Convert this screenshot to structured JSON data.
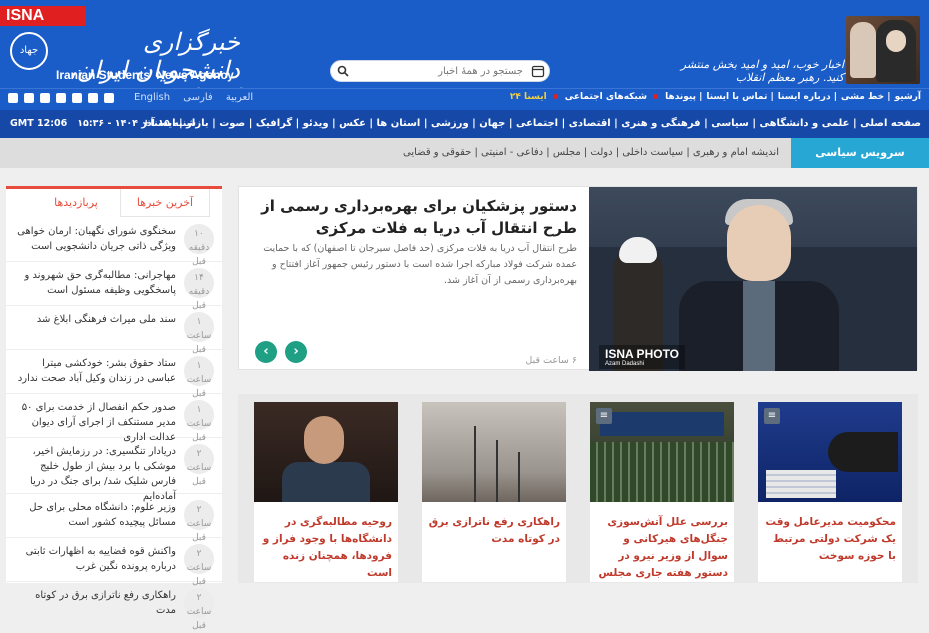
{
  "header": {
    "badge": "ISNA",
    "logo_text": "جهاد",
    "brand_fa": "خبرگزاری دانشجویان ایران، ایسنا",
    "brand_en": "Iranian Students' News Agency",
    "slogan": "اخبار خوب، امید و امید بخش منتشر کنید. رهبر معظم انقلاب",
    "search_placeholder": "جستجو در همهٔ اخبار"
  },
  "topbar": {
    "links": [
      "آرشیو",
      "خط مشی",
      "درباره ایسنا",
      "تماس با ایسنا",
      "پیوندها",
      "شبکه‌های اجتماعی",
      "ایسنا",
      "ایسنا ۲۴"
    ],
    "languages": [
      "فارسی",
      "العربیة",
      "English"
    ],
    "social_icons": [
      "telegram-icon",
      "whatsapp-icon",
      "youtube-icon",
      "twitter-icon",
      "instagram-icon",
      "facebook-icon",
      "rss-icon",
      "aparat-icon"
    ]
  },
  "menubar": {
    "items": "صفحه اصلی | علمی و دانشگاهی | سیاسی | فرهنگی و هنری | اقتصادی | اجتماعی | جهان | ورزشی | استان ها | عکس | ویدئو | گرافیک | صوت | بازار | ایسنا+",
    "date": "شنبه ۱۵ آذر ۱۴۰۴ - ۱۵:۳۶",
    "gmt": "GMT 12:06"
  },
  "subnav": {
    "section": "سرویس سیاسی",
    "items": "اندیشه امام و رهبری | سیاست داخلی | دولت | مجلس | دفاعی - امنیتی | حقوقی و قضایی"
  },
  "sidebar": {
    "tab_active": "آخرین خبرها",
    "tab_inactive": "پربازدیدها",
    "news": [
      {
        "title": "سخنگوی شورای نگهبان: ارمان خواهی ویژگی ذاتی جریان دانشجویی است",
        "time": "۱۰ دقیقه قبل"
      },
      {
        "title": "مهاجرانی: مطالبه‌گری حق شهروند و پاسخگویی وظیفه مسئول است",
        "time": "۱۴ دقیقه قبل"
      },
      {
        "title": "سند ملی میراث فرهنگی ابلاغ شد",
        "time": "۱ ساعت قبل"
      },
      {
        "title": "ستاد حقوق بشر: خودکشی میترا عباسی در زندان وکیل آباد صحت ندارد",
        "time": "۱ ساعت قبل"
      },
      {
        "title": "صدور حکم انفصال از خدمت برای ۵۰ مدیر مستنکف از اجرای آرای دیوان عدالت اداری",
        "time": "۱ ساعت قبل"
      },
      {
        "title": "دریادار تنگسیری: در رزمایش اخیر، موشکی با برد بیش از طول خلیج فارس شلیک شد/ برای جنگ در دریا آماده‌ایم",
        "time": "۲ ساعت قبل"
      },
      {
        "title": "وزیر علوم: دانشگاه محلی برای حل مسائل پیچیده کشور است",
        "time": "۲ ساعت قبل"
      },
      {
        "title": "واکنش قوه قضاییه به اظهارات ثابتی درباره پرونده نگین غرب",
        "time": "۲ ساعت قبل"
      },
      {
        "title": "راهکاری رفع ناترازی برق در کوتاه مدت",
        "time": "۲ ساعت قبل"
      }
    ]
  },
  "feature": {
    "headline": "دستور پزشکیان برای بهره‌برداری رسمی از طرح انتقال آب دریا به فلات مرکزی",
    "lead": "طرح انتقال آب دریا به فلات مرکزی (حد فاصل سیرجان تا اصفهان) که با حمایت عمده شرکت فولاد مبارکه اجرا شده است با دستور رئیس جمهور آغاز افتتاح و بهره‌برداری رسمی از آن آغاز شد.",
    "time": "۶ ساعت قبل",
    "photo_credit": "ISNA PHOTO",
    "photographer": "Azam Dadashi"
  },
  "cards": [
    {
      "title": "روحیه مطالبه‌گری در دانشگاه‌ها با وجود فراز و فرودها، همچنان زنده است"
    },
    {
      "title": "راهکاری رفع ناترازی برق در کوتاه مدت"
    },
    {
      "title": "بررسی علل آتش‌سوزی جنگل‌های هیرکانی و سوال از وزیر نیرو در دستور هفته جاری مجلس"
    },
    {
      "title": "محکومیت مدیرعامل وقت یک شرکت دولتی مرتبط با حوزه سوخت"
    }
  ],
  "colors": {
    "brand_blue": "#1a5cc8",
    "accent_red": "#e74c3c",
    "teal": "#1fa085",
    "section_blue": "#27a7d4"
  }
}
